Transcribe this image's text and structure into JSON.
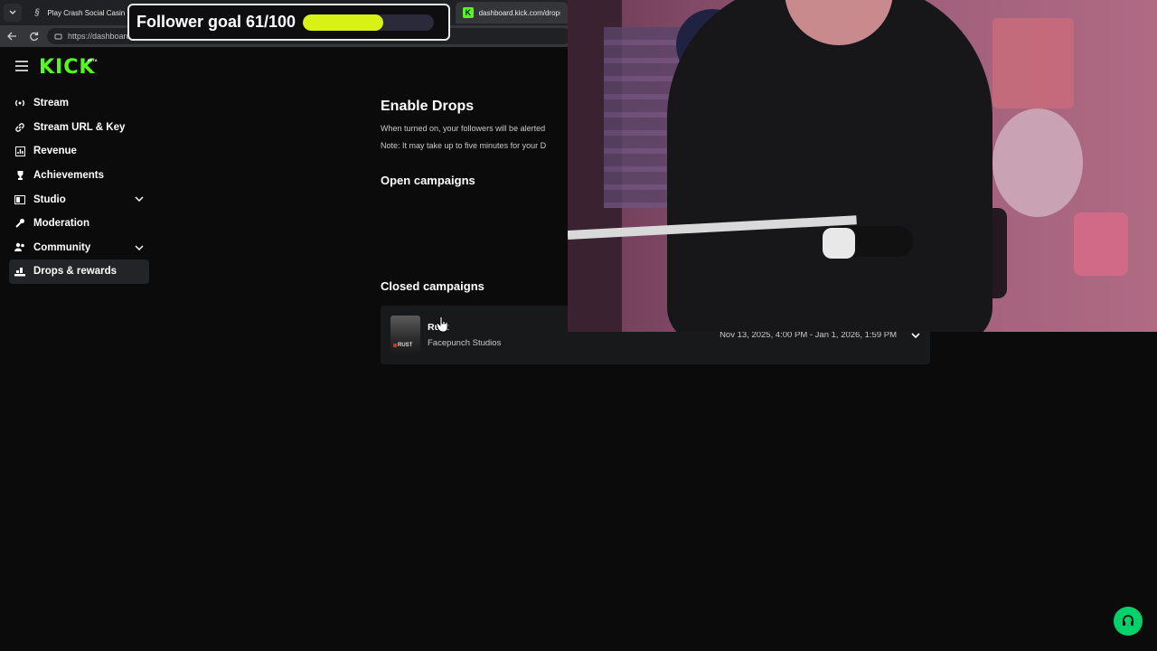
{
  "browser": {
    "tabs": [
      {
        "title": "Play Crash Social Casino G"
      },
      {
        "title": "dashboard.kick.com/drops"
      }
    ],
    "url": "https://dashboard"
  },
  "overlay": {
    "follower_goal_label": "Follower goal 61/100",
    "follower_goal_progress": 0.61,
    "accent": "#d8f215"
  },
  "header": {
    "logo": "KICK",
    "badge": "BETA",
    "brand_color": "#53fc18"
  },
  "sidebar": {
    "items": [
      {
        "label": "Stream",
        "icon": "broadcast-icon"
      },
      {
        "label": "Stream URL & Key",
        "icon": "link-icon"
      },
      {
        "label": "Revenue",
        "icon": "chart-icon"
      },
      {
        "label": "Achievements",
        "icon": "trophy-icon"
      },
      {
        "label": "Studio",
        "icon": "studio-icon",
        "expandable": true
      },
      {
        "label": "Moderation",
        "icon": "wrench-icon"
      },
      {
        "label": "Community",
        "icon": "people-icon",
        "expandable": true
      },
      {
        "label": "Drops & rewards",
        "icon": "drops-icon",
        "active": true
      }
    ]
  },
  "main": {
    "title": "Enable Drops",
    "description": "When turned on, your followers will be alerted",
    "note": "Note: It may take up to five minutes for your D",
    "open_campaigns_title": "Open campaigns",
    "closed_campaigns_title": "Closed campaigns",
    "closed_campaigns": [
      {
        "name": "Rust",
        "studio": "Facepunch Studios",
        "dates": "Nov 13, 2025, 4:00 PM - Jan 1, 2026, 1:59 PM",
        "thumb_text": "RUST"
      }
    ]
  },
  "support": {
    "color": "#00d26a",
    "icon": "headset-icon"
  }
}
